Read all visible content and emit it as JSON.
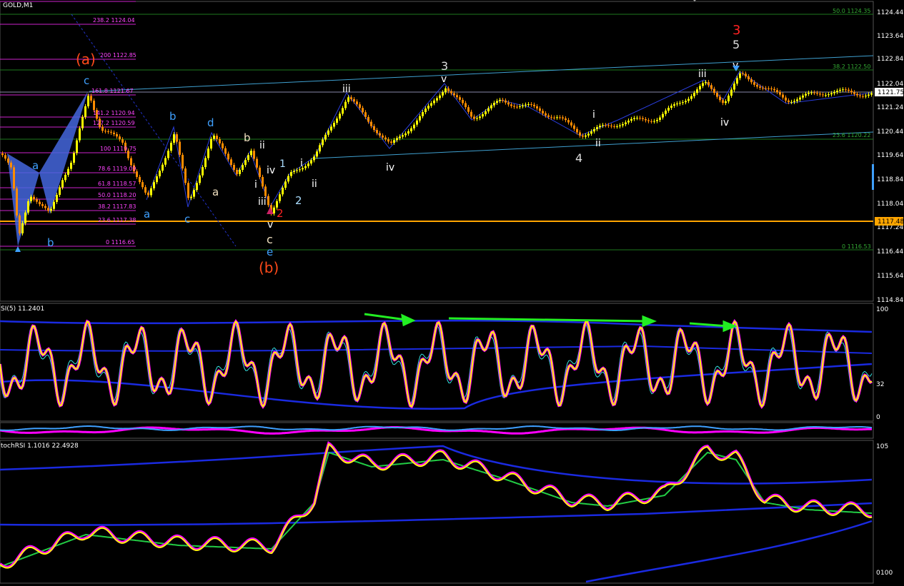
{
  "window": {
    "symbol_title": "GOLD,M1",
    "rsi_title": "SI(5) 11.2401",
    "stoch_title": "tochRSI 1.1016 22.4928"
  },
  "price_axis": {
    "labels": [
      "1124.44",
      "1123.64",
      "1122.84",
      "1122.04",
      "1121.75",
      "1121.24",
      "1120.44",
      "1119.64",
      "1118.84",
      "1118.04",
      "1117.48",
      "1117.24",
      "1116.44",
      "1115.64",
      "1114.84"
    ],
    "current_price": "1121.75",
    "orange_level": "1117.48"
  },
  "rsi_axis": {
    "labels": [
      "100",
      "32",
      "0"
    ]
  },
  "stoch_axis": {
    "labels": [
      "105",
      "0",
      "100"
    ]
  },
  "fib_levels_left": [
    "238.2 1124.04",
    "200 1122.85",
    "161.8 1121.67",
    "141.2 1120.94",
    "127.2 1120.59",
    "100 1119.75",
    "78.6 1119.09",
    "61.8 1118.57",
    "50.0 1118.20",
    "38.2 1117.83",
    "23.6 1117.38",
    "0 1116.65"
  ],
  "fib_levels_right": [
    "50.0 1124.35",
    "38.2 1122.50",
    "23.6 1120.22",
    "0 1116.53"
  ],
  "wave_labels": {
    "a_paren": "(a)",
    "b_paren": "(b)",
    "c_blue": "c",
    "a_blue_left": "a",
    "b_blue_left": "b",
    "b_blue_mid": "b",
    "d_blue": "d",
    "a_blue_low": "a",
    "c_blue_low": "c",
    "a_tan": "a",
    "b_tan": "b",
    "ii_top": "ii",
    "iv_mid": "iv",
    "one_mid": "1",
    "i_mid": "i",
    "iii_mid": "iii",
    "v_low": "v",
    "c_low": "c",
    "e_low": "e",
    "two_red": "2",
    "two_white": "2",
    "i_small": "i",
    "ii_small": "ii",
    "iii_top": "iii",
    "iv_low1": "iv",
    "three_white": "3",
    "v_white1": "v",
    "four_white": "4",
    "i_right": "i",
    "ii_right": "ii",
    "iii_right": "iii",
    "iv_right": "iv",
    "three_red": "3",
    "five_white": "5",
    "v_white2": "v"
  },
  "colors": {
    "background": "#000000",
    "candle_up": "#ffff00",
    "candle_down": "#ff8c00",
    "fib_line": "#cc22cc",
    "channel": "#3fa0d0",
    "orange_level": "#ffa500",
    "rsi_yellow": "#ffff00",
    "rsi_magenta": "#ff00ff",
    "band_blue": "#1a2ae0",
    "arrow_green": "#22ee22"
  }
}
